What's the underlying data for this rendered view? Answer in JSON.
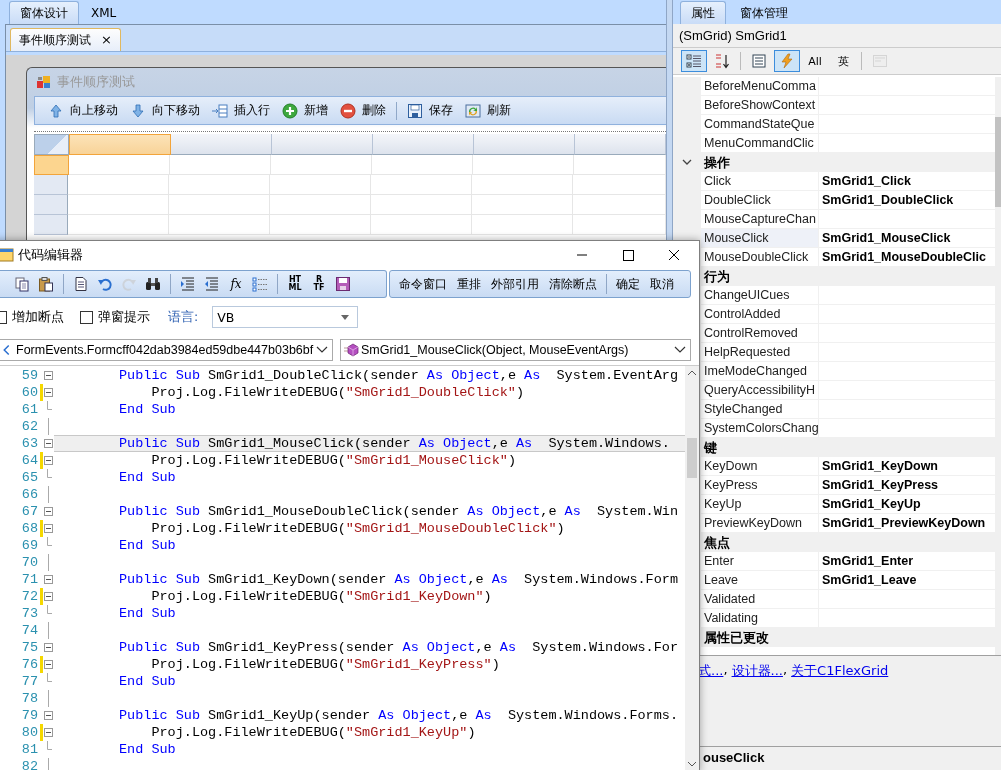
{
  "designer": {
    "tabs": [
      {
        "label": "窗体设计",
        "selected": true
      },
      {
        "label": "XML",
        "selected": false
      }
    ],
    "document_tab": {
      "label": "事件顺序测试",
      "close": "×"
    },
    "form": {
      "title": "事件顺序测试",
      "toolbar": [
        [
          {
            "kind": "up",
            "label": "向上移动"
          },
          {
            "kind": "down",
            "label": "向下移动"
          },
          {
            "kind": "insert",
            "label": "插入行"
          },
          {
            "kind": "add",
            "label": "新增"
          },
          {
            "kind": "remove",
            "label": "删除"
          }
        ],
        [
          {
            "kind": "save",
            "label": "保存"
          },
          {
            "kind": "refresh",
            "label": "刷新"
          }
        ]
      ]
    }
  },
  "properties": {
    "tabs": [
      {
        "label": "属性",
        "selected": true
      },
      {
        "label": "窗体管理",
        "selected": false
      }
    ],
    "object": "(SmGrid) SmGrid1",
    "toolbar": [
      [
        {
          "kind": "categorized",
          "selected": true,
          "disabled": false
        },
        {
          "kind": "alphabetical",
          "selected": false,
          "disabled": false
        }
      ],
      [
        {
          "kind": "property-pages",
          "selected": false,
          "disabled": false
        },
        {
          "kind": "events",
          "selected": true,
          "disabled": false
        },
        {
          "kind": "text",
          "label": "All",
          "selected": false,
          "disabled": false
        },
        {
          "kind": "text",
          "label": "英",
          "selected": false,
          "disabled": false
        }
      ],
      [
        {
          "kind": "pages",
          "selected": false,
          "disabled": true
        }
      ]
    ],
    "groups": [
      {
        "rows": [
          {
            "name": "BeforeMenuComma",
            "selected": false
          },
          {
            "name": "BeforeShowContext",
            "selected": false
          },
          {
            "name": "CommandStateQue",
            "selected": false
          },
          {
            "name": "MenuCommandClic",
            "selected": false
          }
        ]
      },
      {
        "category": "操作",
        "expanded": true,
        "rows": [
          {
            "name": "Click",
            "value": "SmGrid1_Click",
            "selected": false
          },
          {
            "name": "DoubleClick",
            "value": "SmGrid1_DoubleClick",
            "selected": false
          },
          {
            "name": "MouseCaptureChan",
            "selected": false
          },
          {
            "name": "MouseClick",
            "value": "SmGrid1_MouseClick",
            "selected": true
          },
          {
            "name": "MouseDoubleClick",
            "value": "SmGrid1_MouseDoubleClic",
            "selected": false
          }
        ]
      },
      {
        "category": "行为",
        "rows": [
          {
            "name": "ChangeUICues",
            "selected": false
          },
          {
            "name": "ControlAdded",
            "selected": false
          },
          {
            "name": "ControlRemoved",
            "selected": false
          },
          {
            "name": "HelpRequested",
            "selected": false
          },
          {
            "name": "ImeModeChanged",
            "selected": false
          },
          {
            "name": "QueryAccessibilityH",
            "selected": false
          },
          {
            "name": "StyleChanged",
            "selected": false
          },
          {
            "name": "SystemColorsChang",
            "selected": false
          }
        ]
      },
      {
        "category": "键",
        "rows": [
          {
            "name": "KeyDown",
            "value": "SmGrid1_KeyDown",
            "selected": false
          },
          {
            "name": "KeyPress",
            "value": "SmGrid1_KeyPress",
            "selected": false
          },
          {
            "name": "KeyUp",
            "value": "SmGrid1_KeyUp",
            "selected": false
          },
          {
            "name": "PreviewKeyDown",
            "value": "SmGrid1_PreviewKeyDown",
            "selected": false
          }
        ]
      },
      {
        "category": "焦点",
        "rows": [
          {
            "name": "Enter",
            "value": "SmGrid1_Enter",
            "selected": false
          },
          {
            "name": "Leave",
            "value": "SmGrid1_Leave",
            "selected": false
          },
          {
            "name": "Validated",
            "selected": false
          },
          {
            "name": "Validating",
            "selected": false
          }
        ]
      },
      {
        "category": "属性已更改"
      }
    ],
    "links": [
      "式...",
      "设计器...",
      "关于C1FlexGrid"
    ],
    "link_separator": ",",
    "description": {
      "title": "ouseClick"
    }
  },
  "code_editor": {
    "title": "代码编辑器",
    "toolbar": [
      [
        {
          "kind": "copy",
          "disabled": false
        },
        {
          "kind": "paste",
          "disabled": false
        }
      ],
      [
        {
          "kind": "document",
          "disabled": false
        },
        {
          "kind": "undo",
          "disabled": false
        },
        {
          "kind": "redo",
          "disabled": true
        },
        {
          "kind": "find",
          "disabled": false
        }
      ],
      [
        {
          "kind": "indent",
          "disabled": false
        },
        {
          "kind": "outdent",
          "disabled": false
        },
        {
          "kind": "text",
          "label": "fx",
          "disabled": false
        },
        {
          "kind": "list",
          "disabled": false
        }
      ],
      [
        {
          "kind": "stacked",
          "lines": [
            "HT",
            "ML"
          ],
          "disabled": false
        },
        {
          "kind": "stacked",
          "lines": [
            "R",
            "TF"
          ],
          "disabled": false
        },
        {
          "kind": "save",
          "disabled": false
        }
      ]
    ],
    "commands": [
      [
        "命令窗口",
        "重排",
        "外部引用",
        "清除断点"
      ],
      [
        "确定",
        "取消"
      ]
    ],
    "options": [
      {
        "label": "增加断点",
        "checked": false
      },
      {
        "label": "弹窗提示",
        "checked": false
      }
    ],
    "language_label": "语言:",
    "language": "VB",
    "class_select": "FormEvents.Formcff042dab3984ed59dbe447b03b6bf",
    "method_select": "SmGrid1_MouseClick(Object, MouseEventArgs)",
    "lines": [
      {
        "n": "59",
        "kind": "start",
        "changed": false,
        "current": false,
        "tokens": [
          {
            "kind": "kw",
            "text": "Public Sub"
          },
          {
            "kind": "plain",
            "text": " SmGrid1_DoubleClick(sender "
          },
          {
            "kind": "kw",
            "text": "As Object"
          },
          {
            "kind": "plain",
            "text": ",e "
          },
          {
            "kind": "kw",
            "text": "As"
          },
          {
            "kind": "plain",
            "text": "  System.EventArg"
          }
        ]
      },
      {
        "n": "60",
        "kind": "start",
        "changed": true,
        "current": false,
        "tokens": [
          {
            "kind": "plain",
            "text": "    Proj.Log.FileWriteDEBUG("
          },
          {
            "kind": "str",
            "text": "\"SmGrid1_DoubleClick\""
          },
          {
            "kind": "plain",
            "text": ")"
          }
        ]
      },
      {
        "n": "61",
        "kind": "end",
        "changed": false,
        "current": false,
        "tokens": [
          {
            "kind": "kw",
            "text": "End Sub"
          }
        ]
      },
      {
        "n": "62",
        "kind": "blank",
        "changed": false,
        "current": false
      },
      {
        "n": "63",
        "kind": "start",
        "changed": false,
        "current": true,
        "tokens": [
          {
            "kind": "kw",
            "text": "Public Sub"
          },
          {
            "kind": "plain",
            "text": " SmGrid1_MouseClick(sender "
          },
          {
            "kind": "kw",
            "text": "As Object"
          },
          {
            "kind": "plain",
            "text": ",e "
          },
          {
            "kind": "kw",
            "text": "As"
          },
          {
            "kind": "plain",
            "text": "  System.Windows."
          }
        ]
      },
      {
        "n": "64",
        "kind": "start",
        "changed": true,
        "current": false,
        "tokens": [
          {
            "kind": "plain",
            "text": "    Proj.Log.FileWriteDEBUG("
          },
          {
            "kind": "str",
            "text": "\"SmGrid1_MouseClick\""
          },
          {
            "kind": "plain",
            "text": ")"
          }
        ]
      },
      {
        "n": "65",
        "kind": "end",
        "changed": false,
        "current": false,
        "tokens": [
          {
            "kind": "kw",
            "text": "End Sub"
          }
        ]
      },
      {
        "n": "66",
        "kind": "blank",
        "changed": false,
        "current": false
      },
      {
        "n": "67",
        "kind": "start",
        "changed": false,
        "current": false,
        "tokens": [
          {
            "kind": "kw",
            "text": "Public Sub"
          },
          {
            "kind": "plain",
            "text": " SmGrid1_MouseDoubleClick(sender "
          },
          {
            "kind": "kw",
            "text": "As Object"
          },
          {
            "kind": "plain",
            "text": ",e "
          },
          {
            "kind": "kw",
            "text": "As"
          },
          {
            "kind": "plain",
            "text": "  System.Win"
          }
        ]
      },
      {
        "n": "68",
        "kind": "start",
        "changed": true,
        "current": false,
        "tokens": [
          {
            "kind": "plain",
            "text": "    Proj.Log.FileWriteDEBUG("
          },
          {
            "kind": "str",
            "text": "\"SmGrid1_MouseDoubleClick\""
          },
          {
            "kind": "plain",
            "text": ")"
          }
        ]
      },
      {
        "n": "69",
        "kind": "end",
        "changed": false,
        "current": false,
        "tokens": [
          {
            "kind": "kw",
            "text": "End Sub"
          }
        ]
      },
      {
        "n": "70",
        "kind": "blank",
        "changed": false,
        "current": false
      },
      {
        "n": "71",
        "kind": "start",
        "changed": false,
        "current": false,
        "tokens": [
          {
            "kind": "kw",
            "text": "Public Sub"
          },
          {
            "kind": "plain",
            "text": " SmGrid1_KeyDown(sender "
          },
          {
            "kind": "kw",
            "text": "As Object"
          },
          {
            "kind": "plain",
            "text": ",e "
          },
          {
            "kind": "kw",
            "text": "As"
          },
          {
            "kind": "plain",
            "text": "  System.Windows.Form"
          }
        ]
      },
      {
        "n": "72",
        "kind": "start",
        "changed": true,
        "current": false,
        "tokens": [
          {
            "kind": "plain",
            "text": "    Proj.Log.FileWriteDEBUG("
          },
          {
            "kind": "str",
            "text": "\"SmGrid1_KeyDown\""
          },
          {
            "kind": "plain",
            "text": ")"
          }
        ]
      },
      {
        "n": "73",
        "kind": "end",
        "changed": false,
        "current": false,
        "tokens": [
          {
            "kind": "kw",
            "text": "End Sub"
          }
        ]
      },
      {
        "n": "74",
        "kind": "blank",
        "changed": false,
        "current": false
      },
      {
        "n": "75",
        "kind": "start",
        "changed": false,
        "current": false,
        "tokens": [
          {
            "kind": "kw",
            "text": "Public Sub"
          },
          {
            "kind": "plain",
            "text": " SmGrid1_KeyPress(sender "
          },
          {
            "kind": "kw",
            "text": "As Object"
          },
          {
            "kind": "plain",
            "text": ",e "
          },
          {
            "kind": "kw",
            "text": "As"
          },
          {
            "kind": "plain",
            "text": "  System.Windows.For"
          }
        ]
      },
      {
        "n": "76",
        "kind": "start",
        "changed": true,
        "current": false,
        "tokens": [
          {
            "kind": "plain",
            "text": "    Proj.Log.FileWriteDEBUG("
          },
          {
            "kind": "str",
            "text": "\"SmGrid1_KeyPress\""
          },
          {
            "kind": "plain",
            "text": ")"
          }
        ]
      },
      {
        "n": "77",
        "kind": "end",
        "changed": false,
        "current": false,
        "tokens": [
          {
            "kind": "kw",
            "text": "End Sub"
          }
        ]
      },
      {
        "n": "78",
        "kind": "blank",
        "changed": false,
        "current": false
      },
      {
        "n": "79",
        "kind": "start",
        "changed": false,
        "current": false,
        "tokens": [
          {
            "kind": "kw",
            "text": "Public Sub"
          },
          {
            "kind": "plain",
            "text": " SmGrid1_KeyUp(sender "
          },
          {
            "kind": "kw",
            "text": "As Object"
          },
          {
            "kind": "plain",
            "text": ",e "
          },
          {
            "kind": "kw",
            "text": "As"
          },
          {
            "kind": "plain",
            "text": "  System.Windows.Forms."
          }
        ]
      },
      {
        "n": "80",
        "kind": "start",
        "changed": true,
        "current": false,
        "tokens": [
          {
            "kind": "plain",
            "text": "    Proj.Log.FileWriteDEBUG("
          },
          {
            "kind": "str",
            "text": "\"SmGrid1_KeyUp\""
          },
          {
            "kind": "plain",
            "text": ")"
          }
        ]
      },
      {
        "n": "81",
        "kind": "end",
        "changed": false,
        "current": false,
        "tokens": [
          {
            "kind": "kw",
            "text": "End Sub"
          }
        ]
      },
      {
        "n": "82",
        "kind": "blank",
        "changed": false,
        "current": false
      }
    ]
  }
}
